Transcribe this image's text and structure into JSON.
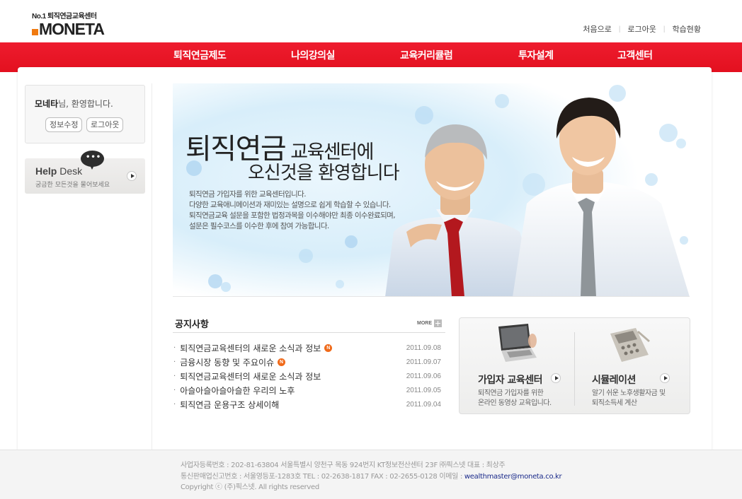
{
  "header": {
    "logo_tag": "No.1 퇴직연금교육센터",
    "logo_word": "MONETA",
    "util_links": [
      "처음으로",
      "로그아웃",
      "학습현황"
    ]
  },
  "gnb": [
    "퇴직연금제도",
    "나의강의실",
    "교육커리큘럼",
    "투자설계",
    "고객센터"
  ],
  "login": {
    "user_name": "모네타",
    "welcome_suffix": "님, 환영합니다.",
    "edit_button": "정보수정",
    "logout_button": "로그아웃"
  },
  "help": {
    "title_bold": "Help",
    "title_rest": " Desk",
    "subtitle": "궁금한 모든것을 물어보세요"
  },
  "hero": {
    "title_big": "퇴직연금",
    "title_mid": " 교육센터",
    "title_end": "에",
    "title_line2": "오신것을 환영합니다",
    "desc": [
      "퇴직연금 가입자를 위한 교육센터입니다.",
      "다양한 교육애니메이션과 재미있는 설명으로 쉽게 학습할 수 있습니다.",
      "퇴직연금교육 설문을 포함한 법정과목을 이수해야만 최종 이수완료되며,",
      "설문은 필수코스를 이수한 후에 참여 가능합니다."
    ]
  },
  "notice": {
    "title": "공지사항",
    "more": "MORE",
    "new_badge": "N",
    "items": [
      {
        "title": "퇴직연금교육센터의 새로운 소식과 정보",
        "date": "2011.09.08",
        "is_new": true
      },
      {
        "title": "금융시장 동향 및 주요이슈",
        "date": "2011.09.07",
        "is_new": true
      },
      {
        "title": "퇴직연금교육센터의 새로운 소식과 정보",
        "date": "2011.09.06",
        "is_new": false
      },
      {
        "title": "아슬아슬아슬아슬한 우리의 노후",
        "date": "2011.09.05",
        "is_new": false
      },
      {
        "title": "퇴직연금 운용구조 상세이해",
        "date": "2011.09.04",
        "is_new": false
      }
    ]
  },
  "promo": {
    "left": {
      "title": "가입자 교육센터",
      "desc": [
        "퇴직연금 가입자를 위한",
        "온라인 동영상 교육입니다."
      ]
    },
    "right": {
      "title": "시뮬레이션",
      "desc": [
        "알기 쉬운 노후생활자금 및",
        "퇴직소득세 계산"
      ]
    }
  },
  "footer": {
    "line1": "사업자등록번호 : 202-81-63804 서울특별시 양천구 목동 924번지 KT정보전산센터 23F ㈜픽스넷 대표 : 최상주",
    "line2_prefix": "통신판매업신고번호 : 서울영등포-1283호 TEL : 02-2638-1817 FAX : 02-2655-0128 이메일 : ",
    "email": "wealthmaster@moneta.co.kr",
    "line3": "Copyright ⓒ (주)픽스넷. All rights reserved"
  },
  "colors": {
    "gnb_red": "#e3101f",
    "logo_orange": "#f07a10",
    "new_badge": "#f06a1a",
    "footer_email": "#1a2a8a"
  },
  "icons": [
    "speech-bubble-icon",
    "arrow-right-icon",
    "plus-icon",
    "laptop-icon",
    "calculator-icon"
  ]
}
